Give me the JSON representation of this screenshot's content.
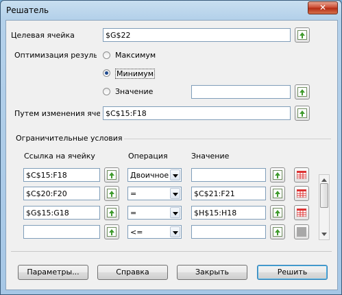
{
  "window": {
    "title": "Решатель",
    "close_glyph": "✕"
  },
  "target_cell": {
    "label": "Целевая ячейка",
    "value": "$G$22"
  },
  "optimize": {
    "label": "Оптимизация результа",
    "options": [
      {
        "label": "Максимум",
        "selected": false
      },
      {
        "label": "Минимум",
        "selected": true
      },
      {
        "label": "Значение",
        "selected": false
      }
    ],
    "value_field": ""
  },
  "changing_cells": {
    "label": "Путем изменения ячее",
    "value": "$C$15:F18"
  },
  "constraints": {
    "section_label": "Ограничительные условия",
    "headers": {
      "cell_ref": "Ссылка на ячейку",
      "operation": "Операция",
      "value": "Значение"
    },
    "rows": [
      {
        "cell_ref": "$C$15:F18",
        "operation": "Двоичное",
        "value": ""
      },
      {
        "cell_ref": "$C$20:F20",
        "operation": "=",
        "value": "$C$21:F21"
      },
      {
        "cell_ref": "$G$15:G18",
        "operation": "=",
        "value": "$H$15:H18"
      },
      {
        "cell_ref": "",
        "operation": "<=",
        "value": ""
      }
    ]
  },
  "buttons": {
    "options": "Параметры...",
    "help": "Справка",
    "close": "Закрыть",
    "solve": "Решить"
  },
  "icons": {
    "shrink": "shrink-range-icon",
    "delete": "remove-constraint-icon"
  }
}
